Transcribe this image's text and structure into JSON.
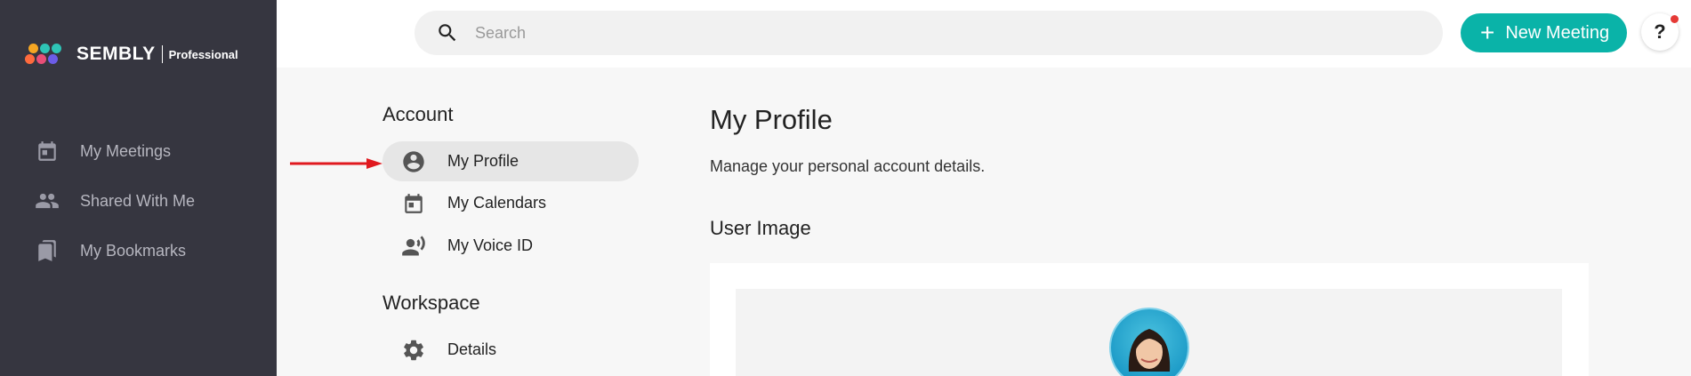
{
  "brand": {
    "name": "SEMBLY",
    "plan": "Professional",
    "logo_colors": [
      "#f5a623",
      "#2ec4b6",
      "#e94e77",
      "#6c5ce7",
      "#ff7f2a"
    ]
  },
  "sidebar": {
    "items": [
      {
        "label": "My Meetings",
        "icon": "calendar-icon"
      },
      {
        "label": "Shared With Me",
        "icon": "people-icon"
      },
      {
        "label": "My Bookmarks",
        "icon": "bookmarks-icon"
      }
    ]
  },
  "topbar": {
    "search_placeholder": "Search",
    "new_meeting_label": "New Meeting",
    "new_meeting_plus": "+",
    "help_label": "?"
  },
  "settings_menu": {
    "account_title": "Account",
    "account_items": [
      {
        "label": "My Profile",
        "icon": "account-circle-icon",
        "active": true
      },
      {
        "label": "My Calendars",
        "icon": "calendar-icon",
        "active": false
      },
      {
        "label": "My Voice ID",
        "icon": "voice-id-icon",
        "active": false
      }
    ],
    "workspace_title": "Workspace",
    "workspace_items": [
      {
        "label": "Details",
        "icon": "gear-icon",
        "active": false
      }
    ]
  },
  "content": {
    "title": "My Profile",
    "subtitle": "Manage your personal account details.",
    "user_image_title": "User Image"
  },
  "colors": {
    "accent": "#0ab3a8",
    "sidebar_bg": "#363640",
    "arrow": "#e0191f",
    "notification": "#e53935"
  }
}
